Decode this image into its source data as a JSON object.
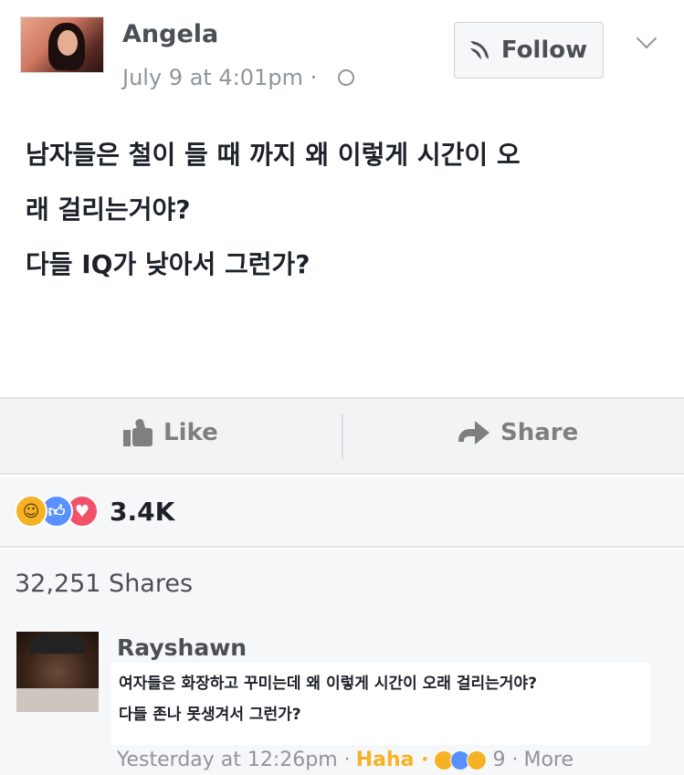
{
  "post": {
    "author": "Angela",
    "timestamp": "July 9 at 4:01pm ·",
    "follow_label": "Follow",
    "body_lines": [
      "남자들은 철이 들 때 까지 왜 이렇게 시간이 오",
      "래 걸리는거야?",
      "다들 IQ가 낮아서 그런가?"
    ]
  },
  "actions": {
    "like_label": "Like",
    "share_label": "Share"
  },
  "reactions": {
    "count": "3.4K",
    "icons": [
      "haha-icon",
      "like-icon",
      "love-icon"
    ]
  },
  "shares": {
    "label": "32,251 Shares"
  },
  "comment": {
    "author": "Rayshawn",
    "lines": [
      "여자들은 화장하고 꾸미는데 왜 이렇게 시간이 오래 걸리는거야?",
      "다들 존나 못생겨서 그런가?"
    ],
    "time": "Yesterday at 12:26pm ·",
    "reaction_label": "Haha ·",
    "reaction_count": "9 ·",
    "more_label": "More"
  },
  "colors": {
    "brand_blue": "#5890ff",
    "haha_yellow": "#f7b125",
    "love_red": "#f25268",
    "meta_gray": "#90949c"
  }
}
